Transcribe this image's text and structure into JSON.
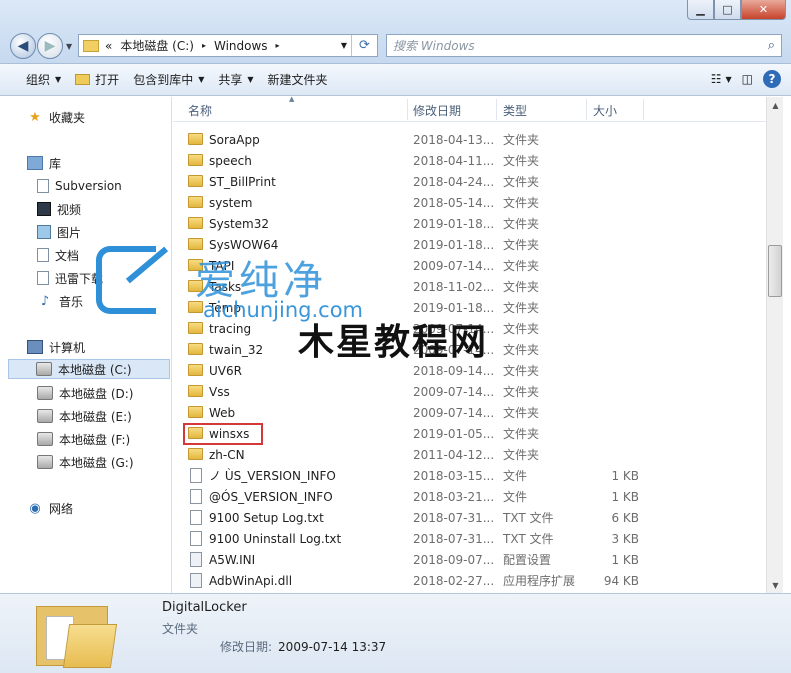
{
  "window": {
    "btn_min": "▁",
    "btn_max": "□",
    "btn_close": "✕"
  },
  "nav": {
    "back_glyph": "◀",
    "forward_glyph": "▶",
    "dropdown_glyph": "▼"
  },
  "address": {
    "chevrons": "«",
    "crumbs": [
      "本地磁盘 (C:)",
      "Windows"
    ],
    "sep": "▸",
    "dropdown": "▼",
    "refresh": "⟳"
  },
  "search": {
    "placeholder": "搜索 Windows",
    "icon": "⌕"
  },
  "toolbar": {
    "organize": "组织",
    "open": "打开",
    "include_library": "包含到库中",
    "share": "共享",
    "new_folder": "新建文件夹",
    "views_icon": "☷",
    "views_dropdown": "▼",
    "preview_icon": "◫",
    "help": "?"
  },
  "sidebar": {
    "favorites": "收藏夹",
    "libraries": "库",
    "lib_items": [
      "Subversion",
      "视频",
      "图片",
      "文档",
      "迅雷下载",
      "音乐"
    ],
    "computer": "计算机",
    "drives": [
      "本地磁盘 (C:)",
      "本地磁盘 (D:)",
      "本地磁盘 (E:)",
      "本地磁盘 (F:)",
      "本地磁盘 (G:)"
    ],
    "network": "网络"
  },
  "columns": {
    "name": "名称",
    "date": "修改日期",
    "type": "类型",
    "size": "大小",
    "sort_glyph": "▲"
  },
  "files": [
    {
      "name": "SoraApp",
      "date": "2018-04-13...",
      "type": "文件夹",
      "size": "",
      "kind": "folder"
    },
    {
      "name": "speech",
      "date": "2018-04-11...",
      "type": "文件夹",
      "size": "",
      "kind": "folder"
    },
    {
      "name": "ST_BillPrint",
      "date": "2018-04-24...",
      "type": "文件夹",
      "size": "",
      "kind": "folder"
    },
    {
      "name": "system",
      "date": "2018-05-14...",
      "type": "文件夹",
      "size": "",
      "kind": "folder"
    },
    {
      "name": "System32",
      "date": "2019-01-18...",
      "type": "文件夹",
      "size": "",
      "kind": "folder"
    },
    {
      "name": "SysWOW64",
      "date": "2019-01-18...",
      "type": "文件夹",
      "size": "",
      "kind": "folder"
    },
    {
      "name": "TAPI",
      "date": "2009-07-14...",
      "type": "文件夹",
      "size": "",
      "kind": "folder"
    },
    {
      "name": "Tasks",
      "date": "2018-11-02...",
      "type": "文件夹",
      "size": "",
      "kind": "folder"
    },
    {
      "name": "Temp",
      "date": "2019-01-18...",
      "type": "文件夹",
      "size": "",
      "kind": "folder"
    },
    {
      "name": "tracing",
      "date": "2009-07-14...",
      "type": "文件夹",
      "size": "",
      "kind": "folder"
    },
    {
      "name": "twain_32",
      "date": "2009-07-14...",
      "type": "文件夹",
      "size": "",
      "kind": "folder"
    },
    {
      "name": "UV6R",
      "date": "2018-09-14...",
      "type": "文件夹",
      "size": "",
      "kind": "folder"
    },
    {
      "name": "Vss",
      "date": "2009-07-14...",
      "type": "文件夹",
      "size": "",
      "kind": "folder"
    },
    {
      "name": "Web",
      "date": "2009-07-14...",
      "type": "文件夹",
      "size": "",
      "kind": "folder"
    },
    {
      "name": "winsxs",
      "date": "2019-01-05...",
      "type": "文件夹",
      "size": "",
      "kind": "folder"
    },
    {
      "name": "zh-CN",
      "date": "2011-04-12...",
      "type": "文件夹",
      "size": "",
      "kind": "folder"
    },
    {
      "name": "ノ ÙS_VERSION_INFO",
      "date": "2018-03-15...",
      "type": "文件",
      "size": "1 KB",
      "kind": "file"
    },
    {
      "name": "@ÓS_VERSION_INFO",
      "date": "2018-03-21...",
      "type": "文件",
      "size": "1 KB",
      "kind": "file"
    },
    {
      "name": "9100 Setup Log.txt",
      "date": "2018-07-31...",
      "type": "TXT 文件",
      "size": "6 KB",
      "kind": "file"
    },
    {
      "name": "9100 Uninstall Log.txt",
      "date": "2018-07-31...",
      "type": "TXT 文件",
      "size": "3 KB",
      "kind": "file"
    },
    {
      "name": "A5W.INI",
      "date": "2018-09-07...",
      "type": "配置设置",
      "size": "1 KB",
      "kind": "cfg"
    },
    {
      "name": "AdbWinApi.dll",
      "date": "2018-02-27...",
      "type": "应用程序扩展",
      "size": "94 KB",
      "kind": "cfg"
    }
  ],
  "scrollbar": {
    "up": "▲",
    "down": "▼"
  },
  "details": {
    "name": "DigitalLocker",
    "type": "文件夹",
    "modified_label": "修改日期:",
    "modified_value": "2009-07-14 13:37"
  },
  "watermark": {
    "brand": "爱纯净",
    "url": "aichunjing.com",
    "cn": "木星教程网"
  },
  "colors": {
    "highlight_box": "#d43838",
    "watermark_blue": "#2e90d8"
  }
}
